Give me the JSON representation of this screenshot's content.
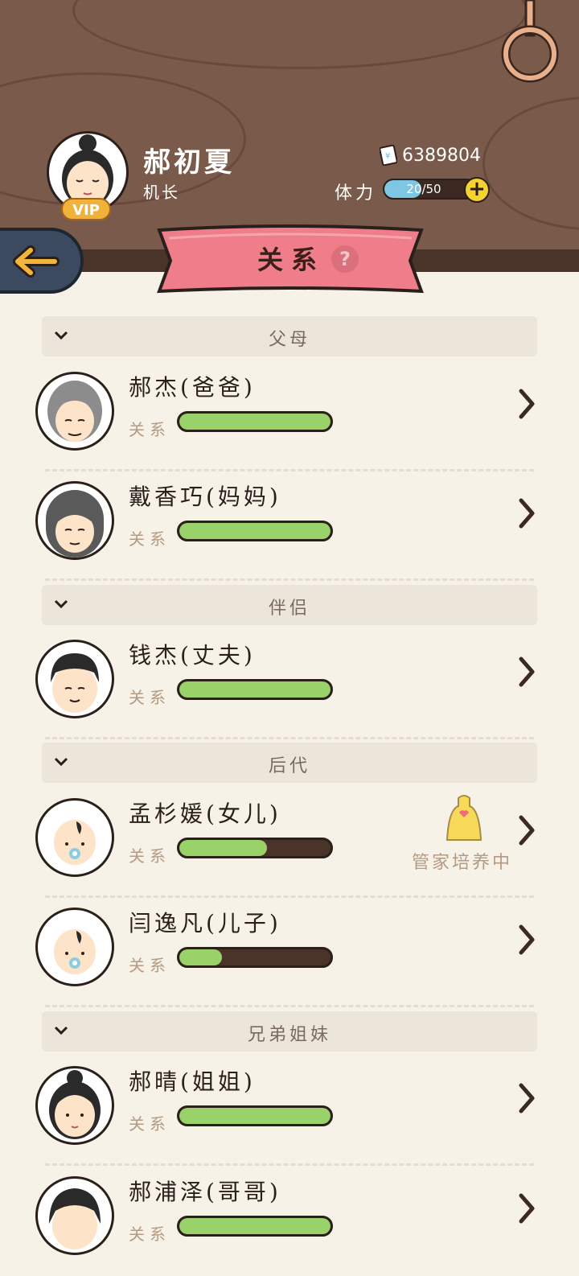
{
  "player": {
    "name": "郝初夏",
    "job": "机长",
    "vip_label": "VIP",
    "money": "6389804",
    "stamina_label": "体力",
    "stamina_text": "20/50",
    "stamina_fraction": 0.4
  },
  "page": {
    "title": "关系",
    "help_label": "?"
  },
  "icons": {
    "back": "back-arrow-icon",
    "help": "help-icon",
    "money": "banknote-icon",
    "plus": "plus-icon",
    "chevron": "chevron-right-icon",
    "collapse": "chevron-down-icon",
    "butler": "apron-icon"
  },
  "colors": {
    "header_wood": "#7a5a4a",
    "ribbon": "#ef7e8a",
    "bar_fill": "#9ad26a",
    "stamina_fill": "#7dc7e4"
  },
  "sections": [
    {
      "label": "父母"
    },
    {
      "label": "伴侣"
    },
    {
      "label": "后代"
    },
    {
      "label": "兄弟姐妹"
    }
  ],
  "members": [
    {
      "name": "郝杰(爸爸)",
      "relation_label": "关系",
      "relation_level": 1.0
    },
    {
      "name": "戴香巧(妈妈)",
      "relation_label": "关系",
      "relation_level": 1.0
    },
    {
      "name": "钱杰(丈夫)",
      "relation_label": "关系",
      "relation_level": 1.0
    },
    {
      "name": "孟杉媛(女儿)",
      "relation_label": "关系",
      "relation_level": 0.58,
      "status": "管家培养中"
    },
    {
      "name": "闫逸凡(儿子)",
      "relation_label": "关系",
      "relation_level": 0.28
    },
    {
      "name": "郝晴(姐姐)",
      "relation_label": "关系",
      "relation_level": 1.0
    },
    {
      "name": "郝浦泽(哥哥)",
      "relation_label": "关系",
      "relation_level": 1.0
    }
  ]
}
